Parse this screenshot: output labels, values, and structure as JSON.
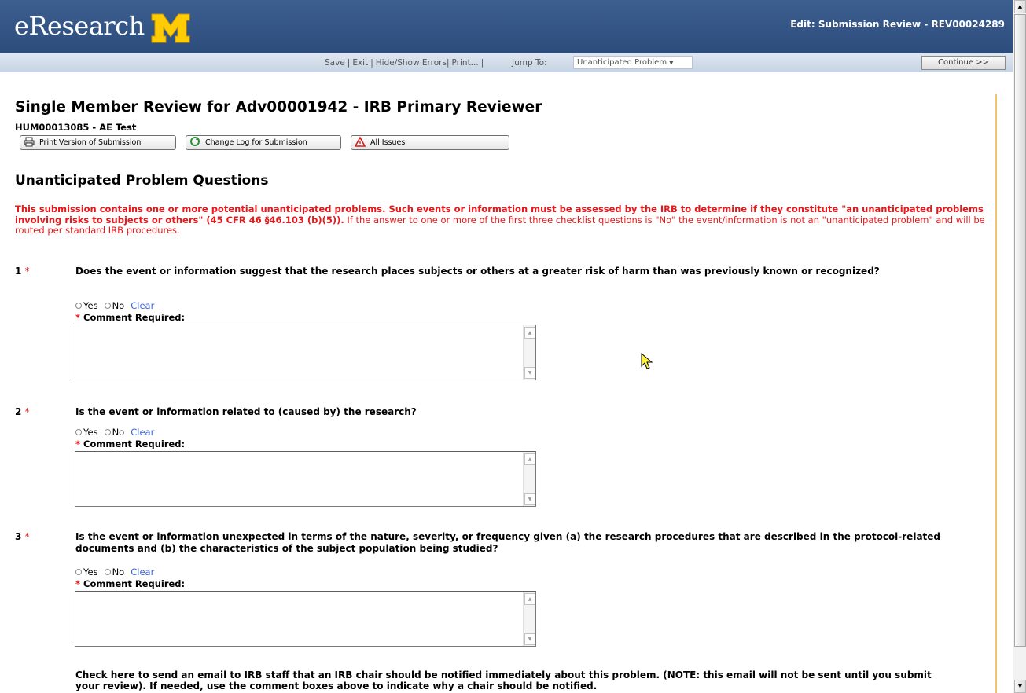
{
  "header": {
    "logo_text": "eResearch",
    "logo_letter": "M",
    "edit_title": "Edit: Submission Review - REV00024289",
    "brand_colors": {
      "banner": "#34578a",
      "logo_m": "#ffcb05"
    }
  },
  "toolbar": {
    "links": [
      "Save",
      "Exit",
      "Hide/Show Errors",
      "Print..."
    ],
    "jump_label": "Jump To:",
    "jump_value": "Unanticipated Problem",
    "continue_label": "Continue >>"
  },
  "page": {
    "title": "Single Member Review for Adv00001942 - IRB Primary Reviewer",
    "subtitle": "HUM00013085 - AE Test",
    "buttons": {
      "print": "Print Version of Submission",
      "changelog": "Change Log for Submission",
      "issues": "All Issues"
    }
  },
  "section": {
    "title": "Unanticipated Problem Questions",
    "warning_bold": "This submission contains one or more potential unanticipated problems. Such events or information must be assessed by the IRB to determine if they constitute \"an unanticipated problems involving risks to subjects or others\" (45 CFR 46 §46.103 (b)(5)).",
    "warning_normal": " If the answer to one or more of the first three checklist questions is \"No\" the event/information is not an \"unanticipated problem\" and will be routed per standard IRB procedures."
  },
  "questions": [
    {
      "num": "1",
      "text": "Does the event or information suggest that the research places subjects or others at a greater risk of harm than was previously known or recognized?"
    },
    {
      "num": "2",
      "text": "Is the event or information related to (caused by) the research?"
    },
    {
      "num": "3",
      "text": "Is the event or information unexpected in terms of the nature, severity, or frequency given (a) the research procedures that are described in the protocol-related documents and (b) the characteristics of the subject population being studied?"
    }
  ],
  "form": {
    "required_star": "*",
    "yes_label": "Yes",
    "no_label": "No",
    "clear_label": "Clear",
    "comment_label": "Comment Required:"
  },
  "bottom_note": "Check here to send an email to IRB staff that an IRB chair should be notified immediately about this problem. (NOTE: this email will not be sent until you submit your review). If needed, use the comment boxes above to indicate why a chair should be notified."
}
